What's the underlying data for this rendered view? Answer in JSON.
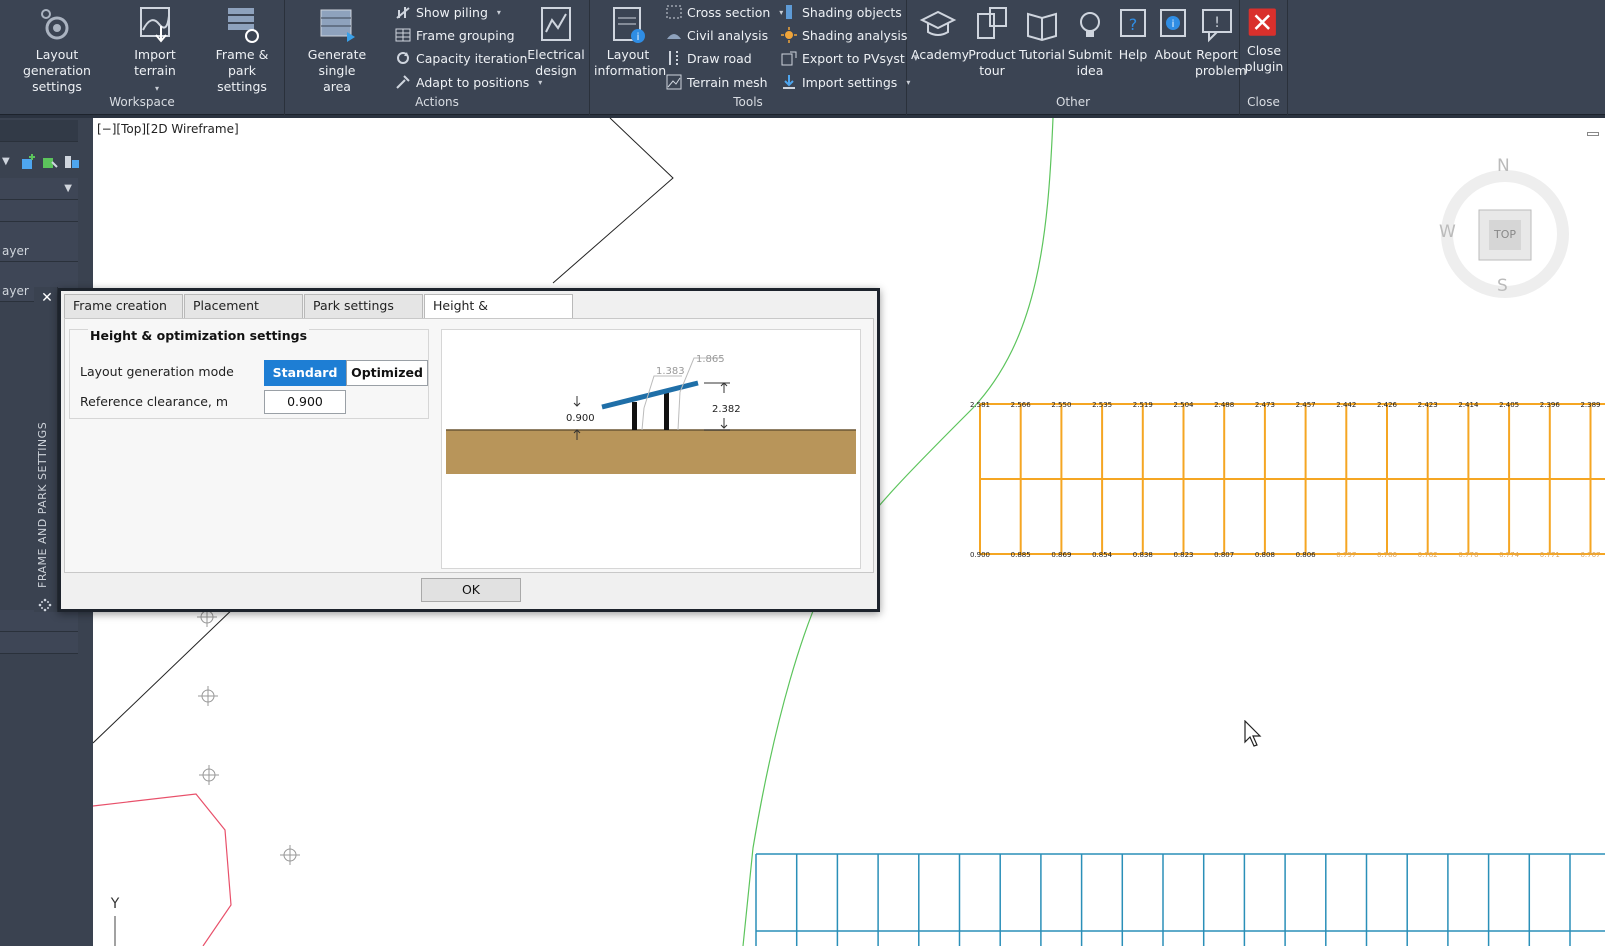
{
  "ribbon": {
    "workspace": {
      "title": "Workspace",
      "layout_gen_line1": "Layout generation",
      "layout_gen_line2": "settings",
      "import_terrain": "Import terrain",
      "frame_park_line1": "Frame & park",
      "frame_park_line2": "settings"
    },
    "actions": {
      "title": "Actions",
      "generate_line1": "Generate single",
      "generate_line2": "area",
      "show_piling": "Show piling",
      "frame_grouping": "Frame grouping",
      "capacity_iteration": "Capacity iteration",
      "adapt_to_positions": "Adapt to positions",
      "electrical_line1": "Electrical",
      "electrical_line2": "design"
    },
    "tools": {
      "title": "Tools",
      "layout_info_line1": "Layout",
      "layout_info_line2": "information",
      "cross_section": "Cross section",
      "civil_analysis": "Civil analysis",
      "draw_road": "Draw road",
      "terrain_mesh": "Terrain mesh",
      "shading_objects": "Shading objects",
      "shading_analysis": "Shading analysis",
      "export_pvsyst": "Export to PVsyst",
      "import_settings": "Import settings"
    },
    "other": {
      "title": "Other",
      "academy": "Academy",
      "product_line1": "Product",
      "product_line2": "tour",
      "tutorial": "Tutorial",
      "submit_line1": "Submit",
      "submit_line2": "idea",
      "help": "Help",
      "about": "About",
      "report_line1": "Report",
      "report_line2": "problem"
    },
    "close": {
      "title": "Close",
      "close_line1": "Close",
      "close_line2": "plugin"
    }
  },
  "left_panel": {
    "layer_row_1": "ayer",
    "layer_row_2": "ayer",
    "vertical_label": "FRAME AND PARK SETTINGS"
  },
  "viewport": {
    "label": "[−][Top][2D Wireframe]",
    "compass": {
      "n": "N",
      "w": "W",
      "s": "S",
      "top": "TOP"
    },
    "axis_y": "Y",
    "top_heights": [
      "2.581",
      "2.566",
      "2.550",
      "2.535",
      "2.519",
      "2.504",
      "2.488",
      "2.473",
      "2.457",
      "2.442",
      "2.426",
      "2.423",
      "2.414",
      "2.405",
      "2.396",
      "2.389"
    ],
    "bottom_heights": [
      "0.900",
      "0.885",
      "0.869",
      "0.854",
      "0.838",
      "0.823",
      "0.807",
      "0.808",
      "0.806",
      "0.797",
      "0.786",
      "0.782",
      "0.776",
      "0.774",
      "0.771",
      "0.767"
    ]
  },
  "dialog": {
    "tabs": [
      "Frame creation",
      "Placement setup",
      "Park settings",
      "Height & Optimization"
    ],
    "section_title": "Height & optimization settings",
    "mode_label": "Layout generation mode",
    "mode_standard": "Standard",
    "mode_optimized": "Optimized",
    "clearance_label": "Reference clearance, m",
    "clearance_value": "0.900",
    "diagram": {
      "dim_left": "1.383",
      "dim_right": "1.865",
      "dim_height": "2.382",
      "dim_clearance": "0.900"
    },
    "ok_label": "OK"
  },
  "colors": {
    "accent": "#1e7ed4",
    "frame_orange": "#f5a623",
    "terrain_green": "#5cc45c",
    "block_blue": "#2a8fb8",
    "boundary_red": "#e8506a",
    "ground_brown": "#b8955a",
    "panel_blue": "#1f6fa8",
    "close_red": "#d9302c"
  }
}
